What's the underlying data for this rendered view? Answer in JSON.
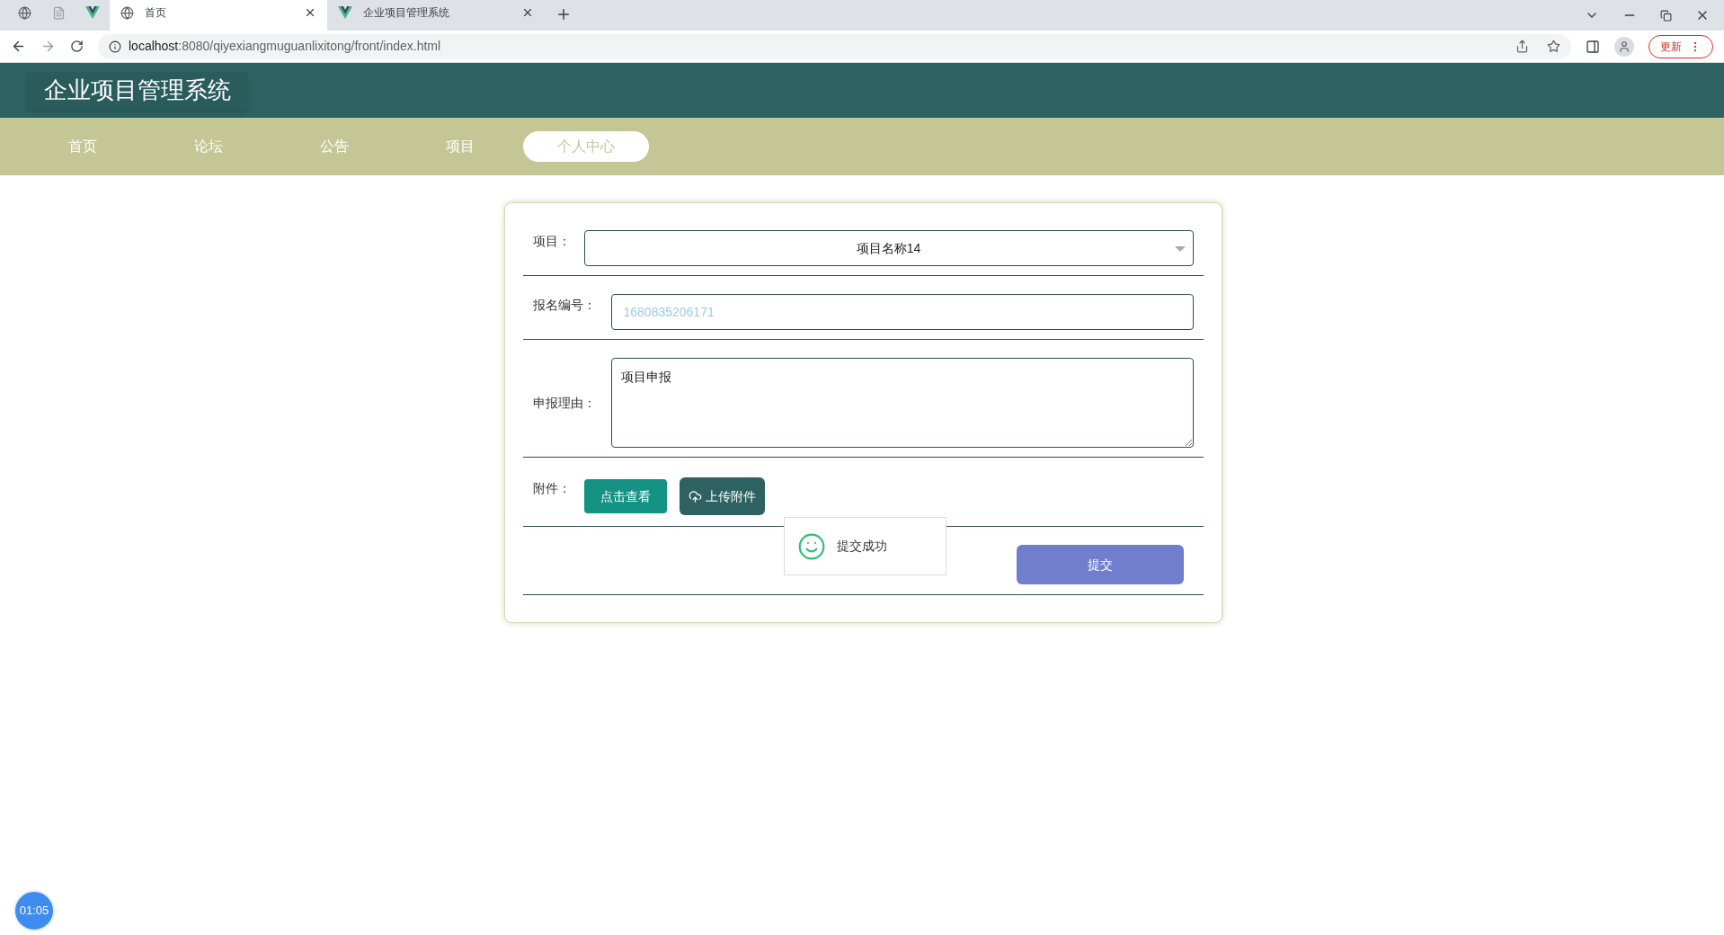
{
  "browser": {
    "tabs": [
      {
        "kind": "pinned-globe",
        "selected": false
      },
      {
        "kind": "pinned-page",
        "selected": false
      },
      {
        "kind": "pinned-vue",
        "selected": false
      },
      {
        "kind": "globe-tab",
        "title": "首页",
        "selected": true
      },
      {
        "kind": "vue-tab",
        "title": "企业项目管理系统",
        "selected": false
      }
    ],
    "url_host": "localhost",
    "url_rest": ":8080/qiyexiangmuguanlixitong/front/index.html",
    "update_label": "更新"
  },
  "site_title": "企业项目管理系统",
  "nav": [
    {
      "label": "首页",
      "selected": false
    },
    {
      "label": "论坛",
      "selected": false
    },
    {
      "label": "公告",
      "selected": false
    },
    {
      "label": "项目",
      "selected": false
    },
    {
      "label": "个人中心",
      "selected": true
    }
  ],
  "form": {
    "project_label": "项目：",
    "project_value": "项目名称14",
    "number_label": "报名编号：",
    "number_placeholder": "1680835206171",
    "reason_label": "申报理由：",
    "reason_value": "项目申报",
    "attachment_label": "附件：",
    "view_button": "点击查看",
    "upload_button": "上传附件",
    "submit_button": "提交"
  },
  "toast": {
    "message": "提交成功"
  },
  "timer": "01:05"
}
